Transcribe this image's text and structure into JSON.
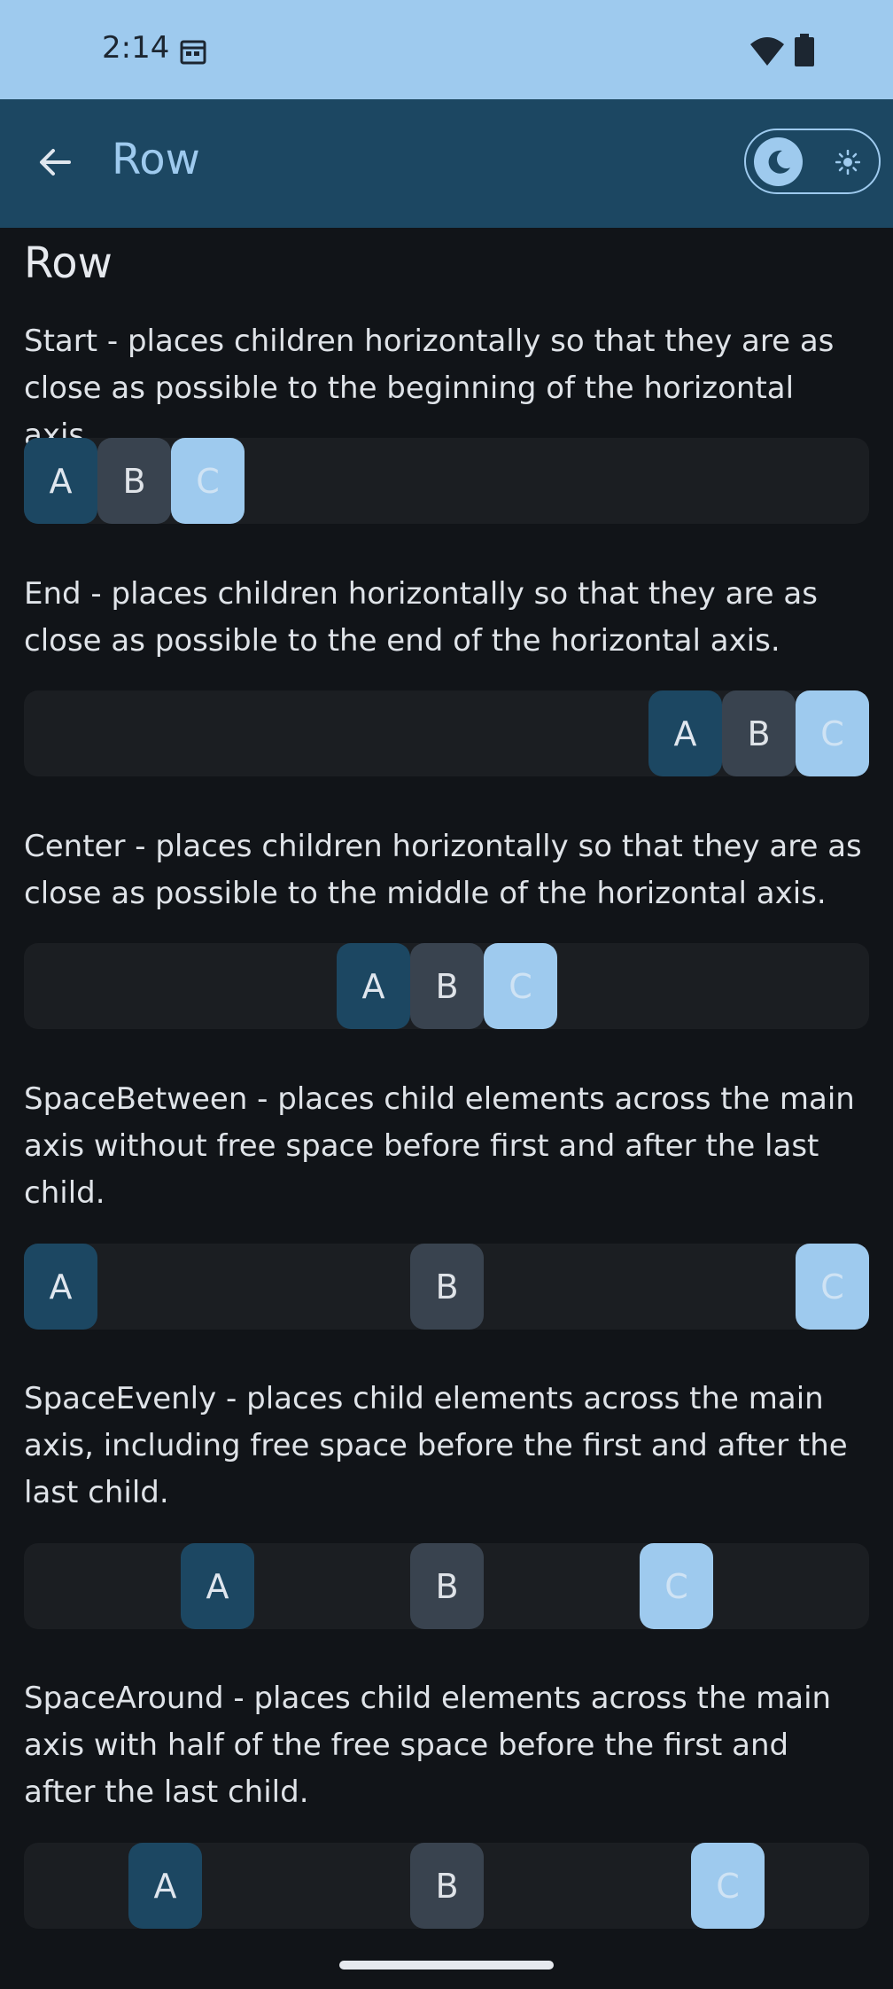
{
  "status_bar": {
    "time": "2:14"
  },
  "app_bar": {
    "title": "Row"
  },
  "page_title": "Row",
  "sections": [
    {
      "description": "Start - places children horizontally so that they are as close as possible to the beginning of the horizontal axis.",
      "boxes": [
        "A",
        "B",
        "C"
      ]
    },
    {
      "description": "End - places children horizontally so that they are as close as possible to the end of the horizontal axis.",
      "boxes": [
        "A",
        "B",
        "C"
      ]
    },
    {
      "description": "Center - places children horizontally so that they are as close as possible to the middle of the horizontal axis.",
      "boxes": [
        "A",
        "B",
        "C"
      ]
    },
    {
      "description": "SpaceBetween - places child elements across the main axis without free space before first and after the last child.",
      "boxes": [
        "A",
        "B",
        "C"
      ]
    },
    {
      "description": "SpaceEvenly - places child elements across the main axis, including free space before the first and after the last child.",
      "boxes": [
        "A",
        "B",
        "C"
      ]
    },
    {
      "description": "SpaceAround - places child elements across the main axis with half of the free space before the first and after the last child.",
      "boxes": [
        "A",
        "B",
        "C"
      ]
    }
  ],
  "colors": {
    "status_bar": "#9ecaee",
    "app_bar": "#1c4762",
    "background": "#111418",
    "box_a": "#1c4762",
    "box_b": "#39434f",
    "box_c": "#9ecaee"
  },
  "icons": [
    "calendar-icon",
    "wifi-icon",
    "battery-icon",
    "back-arrow-icon",
    "moon-icon",
    "sun-icon"
  ]
}
